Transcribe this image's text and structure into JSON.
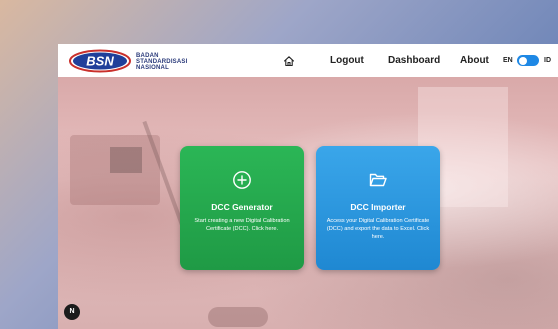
{
  "header": {
    "logo_abbr": "BSN",
    "org_line1": "BADAN",
    "org_line2": "STANDARDISASI",
    "org_line3": "NASIONAL"
  },
  "nav": {
    "home_icon": "home-icon",
    "logout": "Logout",
    "dashboard": "Dashboard",
    "about": "About",
    "lang_left": "EN",
    "lang_right": "ID",
    "lang_toggle_state": "on"
  },
  "cards": {
    "generator": {
      "icon": "plus-circle-icon",
      "title": "DCC Generator",
      "desc": "Start creating a new Digital Calibration Certificate (DCC). Click here."
    },
    "importer": {
      "icon": "folder-open-icon",
      "title": "DCC Importer",
      "desc": "Access your Digital Calibration Certificate (DCC) and export the data to Excel. Click here."
    }
  },
  "avatar": {
    "initial": "N"
  },
  "colors": {
    "generator_bg": "#22a84c",
    "importer_bg": "#2b97de",
    "toggle": "#1e88e5",
    "brand_blue": "#2a3a7a"
  }
}
